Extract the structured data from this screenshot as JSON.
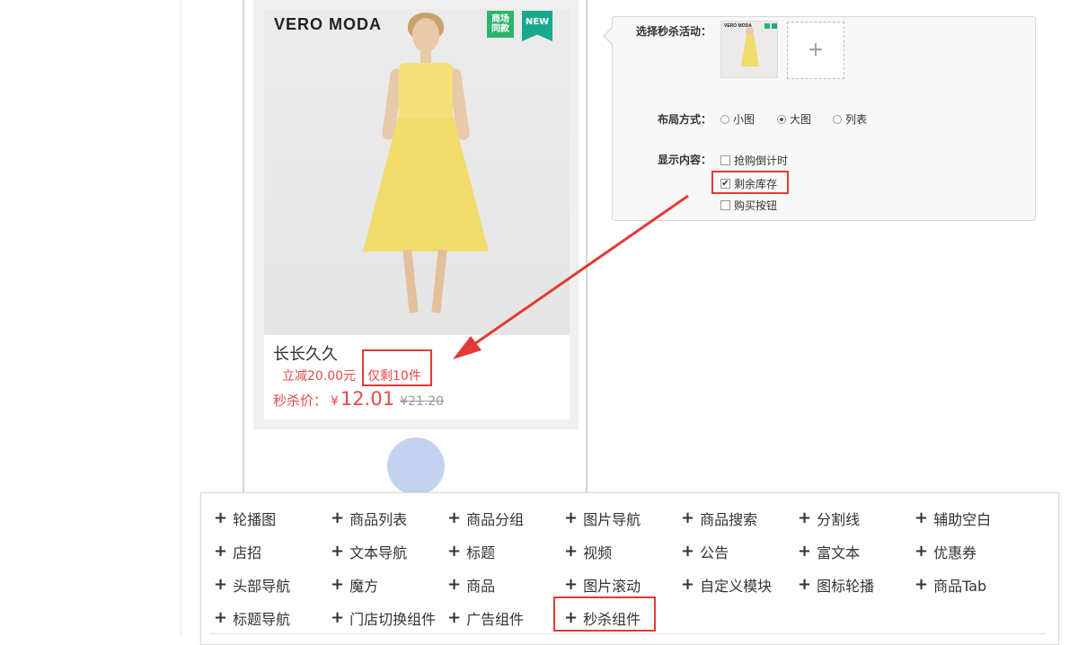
{
  "preview": {
    "brand": "VERO MODA",
    "tag_mall": "商场同款",
    "tag_new": "NEW",
    "product_title": "长长久久",
    "discount_text": "立减20.00元",
    "stock_text": "仅剩10件",
    "price_label": "秒杀价：",
    "currency": "¥",
    "price": "12.01",
    "original_price": "¥21.20"
  },
  "settings": {
    "select_activity_label": "选择秒杀活动：",
    "thumb_brand": "VERO MODA",
    "add_label": "+",
    "layout_label": "布局方式：",
    "layout_options": [
      {
        "label": "小图",
        "selected": false
      },
      {
        "label": "大图",
        "selected": true
      },
      {
        "label": "列表",
        "selected": false
      }
    ],
    "display_label": "显示内容：",
    "display_options": [
      {
        "label": "抢购倒计时",
        "checked": false
      },
      {
        "label": "剩余库存",
        "checked": true
      },
      {
        "label": "购买按钮",
        "checked": false
      }
    ]
  },
  "palette": {
    "items": [
      "轮播图",
      "商品列表",
      "商品分组",
      "图片导航",
      "商品搜索",
      "分割线",
      "辅助空白",
      "店招",
      "文本导航",
      "标题",
      "视频",
      "公告",
      "富文本",
      "优惠券",
      "头部导航",
      "魔方",
      "商品",
      "图片滚动",
      "自定义模块",
      "图标轮播",
      "商品Tab",
      "标题导航",
      "门店切换组件",
      "广告组件",
      "秒杀组件"
    ]
  },
  "colors": {
    "accent_red": "#e53935",
    "price_red": "#e84a4a",
    "tag_green": "#2db46b",
    "tag_teal": "#17a98c",
    "drag_dot": "#c4d2ef"
  },
  "icons": {
    "palette_item_icon": "plus-icon",
    "add_activity_icon": "plus-icon"
  }
}
